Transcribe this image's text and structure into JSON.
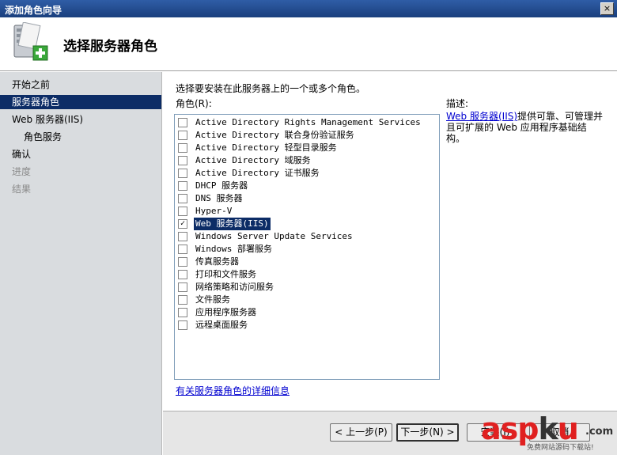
{
  "window": {
    "title": "添加角色向导",
    "close_glyph": "×"
  },
  "header": {
    "title": "选择服务器角色",
    "icon": "server-roles-wizard-icon"
  },
  "nav": {
    "items": [
      {
        "label": "开始之前",
        "state": "normal"
      },
      {
        "label": "服务器角色",
        "state": "active"
      },
      {
        "label": "Web 服务器(IIS)",
        "state": "normal"
      },
      {
        "label": "角色服务",
        "state": "sub"
      },
      {
        "label": "确认",
        "state": "normal"
      },
      {
        "label": "进度",
        "state": "disabled"
      },
      {
        "label": "结果",
        "state": "disabled"
      }
    ]
  },
  "main": {
    "instruction": "选择要安装在此服务器上的一个或多个角色。",
    "roles_label": "角色(R):",
    "description_label": "描述:",
    "description_link": "Web 服务器(IIS)",
    "description_text": "提供可靠、可管理并且可扩展的 Web 应用程序基础结构。",
    "more_info_link": "有关服务器角色的详细信息",
    "roles": [
      {
        "name": "Active Directory Rights Management Services",
        "checked": false,
        "selected": false
      },
      {
        "name": "Active Directory 联合身份验证服务",
        "checked": false,
        "selected": false
      },
      {
        "name": "Active Directory 轻型目录服务",
        "checked": false,
        "selected": false
      },
      {
        "name": "Active Directory 域服务",
        "checked": false,
        "selected": false
      },
      {
        "name": "Active Directory 证书服务",
        "checked": false,
        "selected": false
      },
      {
        "name": "DHCP 服务器",
        "checked": false,
        "selected": false
      },
      {
        "name": "DNS 服务器",
        "checked": false,
        "selected": false
      },
      {
        "name": "Hyper-V",
        "checked": false,
        "selected": false
      },
      {
        "name": "Web 服务器(IIS)",
        "checked": true,
        "selected": true
      },
      {
        "name": "Windows Server Update Services",
        "checked": false,
        "selected": false
      },
      {
        "name": "Windows 部署服务",
        "checked": false,
        "selected": false
      },
      {
        "name": "传真服务器",
        "checked": false,
        "selected": false
      },
      {
        "name": "打印和文件服务",
        "checked": false,
        "selected": false
      },
      {
        "name": "网络策略和访问服务",
        "checked": false,
        "selected": false
      },
      {
        "name": "文件服务",
        "checked": false,
        "selected": false
      },
      {
        "name": "应用程序服务器",
        "checked": false,
        "selected": false
      },
      {
        "name": "远程桌面服务",
        "checked": false,
        "selected": false
      }
    ]
  },
  "footer": {
    "prev_label": "< 上一步(P)",
    "next_label": "下一步(N) >",
    "install_label": "安装(I)",
    "cancel_label": "取消"
  },
  "watermark": {
    "brand_a": "asp",
    "brand_b": "k",
    "brand_c": "u",
    "dotcom": ".com",
    "tagline": "免费网站源码下载站!"
  },
  "colors": {
    "selection": "#0c2c66",
    "link": "#0000d0",
    "nav_bg": "#d9dcdf",
    "titlebar": "#1a3f7d"
  }
}
